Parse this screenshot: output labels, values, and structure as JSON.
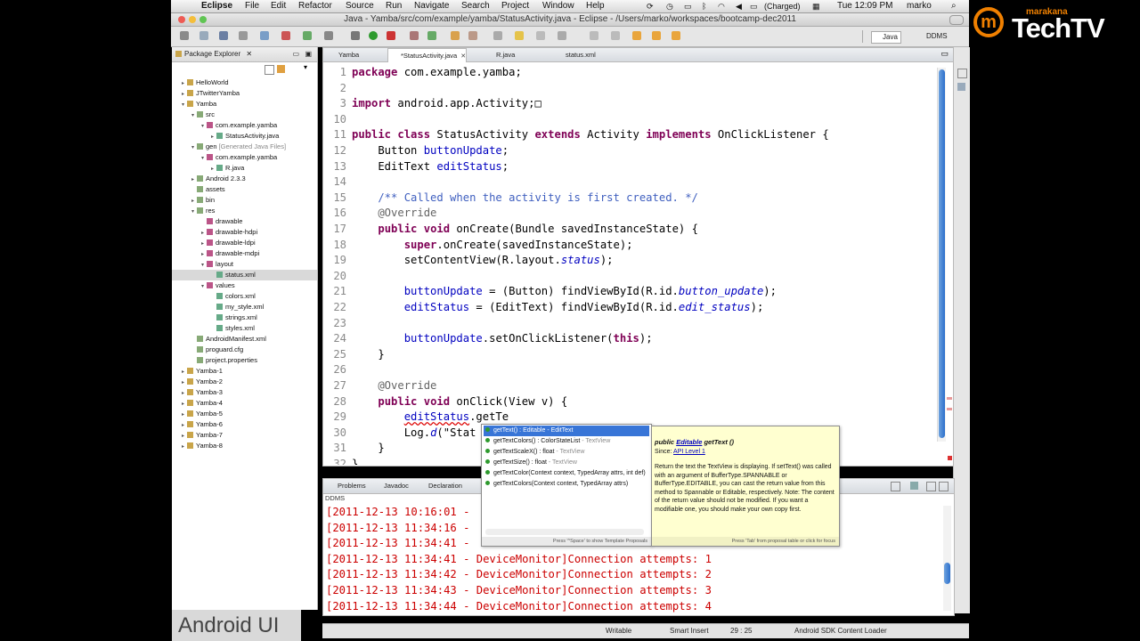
{
  "menubar": {
    "app": "Eclipse",
    "items": [
      "File",
      "Edit",
      "Refactor",
      "Source",
      "Run",
      "Navigate",
      "Search",
      "Project",
      "Window",
      "Help"
    ],
    "battery": "(Charged)",
    "clock": "Tue 12:09 PM",
    "user": "marko"
  },
  "window": {
    "title": "Java - Yamba/src/com/example/yamba/StatusActivity.java - Eclipse - /Users/marko/workspaces/bootcamp-dec2011",
    "perspectives": [
      "Java",
      "DDMS"
    ]
  },
  "package_explorer": {
    "title": "Package Explorer",
    "tree": [
      {
        "label": "HelloWorld",
        "depth": 0,
        "tw": "▸"
      },
      {
        "label": "JTwitterYamba",
        "depth": 0,
        "tw": "▸"
      },
      {
        "label": "Yamba",
        "depth": 0,
        "tw": "▾"
      },
      {
        "label": "src",
        "depth": 1,
        "tw": "▾"
      },
      {
        "label": "com.example.yamba",
        "depth": 2,
        "tw": "▾"
      },
      {
        "label": "StatusActivity.java",
        "depth": 3,
        "tw": "▸"
      },
      {
        "label": "gen",
        "sub": "[Generated Java Files]",
        "depth": 1,
        "tw": "▾"
      },
      {
        "label": "com.example.yamba",
        "depth": 2,
        "tw": "▾"
      },
      {
        "label": "R.java",
        "depth": 3,
        "tw": "▸"
      },
      {
        "label": "Android 2.3.3",
        "depth": 1,
        "tw": "▸"
      },
      {
        "label": "assets",
        "depth": 1,
        "tw": ""
      },
      {
        "label": "bin",
        "depth": 1,
        "tw": "▸"
      },
      {
        "label": "res",
        "depth": 1,
        "tw": "▾"
      },
      {
        "label": "drawable",
        "depth": 2,
        "tw": ""
      },
      {
        "label": "drawable-hdpi",
        "depth": 2,
        "tw": "▸"
      },
      {
        "label": "drawable-ldpi",
        "depth": 2,
        "tw": "▸"
      },
      {
        "label": "drawable-mdpi",
        "depth": 2,
        "tw": "▸"
      },
      {
        "label": "layout",
        "depth": 2,
        "tw": "▾"
      },
      {
        "label": "status.xml",
        "depth": 3,
        "tw": "",
        "selected": true
      },
      {
        "label": "values",
        "depth": 2,
        "tw": "▾"
      },
      {
        "label": "colors.xml",
        "depth": 3,
        "tw": ""
      },
      {
        "label": "my_style.xml",
        "depth": 3,
        "tw": ""
      },
      {
        "label": "strings.xml",
        "depth": 3,
        "tw": ""
      },
      {
        "label": "styles.xml",
        "depth": 3,
        "tw": ""
      },
      {
        "label": "AndroidManifest.xml",
        "depth": 1,
        "tw": ""
      },
      {
        "label": "proguard.cfg",
        "depth": 1,
        "tw": ""
      },
      {
        "label": "project.properties",
        "depth": 1,
        "tw": ""
      },
      {
        "label": "Yamba-1",
        "depth": 0,
        "tw": "▸"
      },
      {
        "label": "Yamba-2",
        "depth": 0,
        "tw": "▸"
      },
      {
        "label": "Yamba-3",
        "depth": 0,
        "tw": "▸"
      },
      {
        "label": "Yamba-4",
        "depth": 0,
        "tw": "▸"
      },
      {
        "label": "Yamba-5",
        "depth": 0,
        "tw": "▸"
      },
      {
        "label": "Yamba-6",
        "depth": 0,
        "tw": "▸"
      },
      {
        "label": "Yamba-7",
        "depth": 0,
        "tw": "▸"
      },
      {
        "label": "Yamba-8",
        "depth": 0,
        "tw": "▸"
      }
    ]
  },
  "editor": {
    "tabs": [
      {
        "label": "Yamba",
        "active": false
      },
      {
        "label": "*StatusActivity.java",
        "active": true
      },
      {
        "label": "R.java",
        "active": false
      },
      {
        "label": "status.xml",
        "active": false
      }
    ],
    "line_numbers": [
      "1",
      "2",
      "3",
      "10",
      "11",
      "12",
      "13",
      "14",
      "15",
      "16",
      "17",
      "18",
      "19",
      "20",
      "21",
      "22",
      "23",
      "24",
      "25",
      "26",
      "27",
      "28",
      "29",
      "30",
      "31",
      "32"
    ],
    "lines": [
      [
        {
          "t": "package",
          "c": "kw"
        },
        {
          "t": " com.example.yamba;"
        }
      ],
      [],
      [
        {
          "t": "import",
          "c": "kw"
        },
        {
          "t": " android.app.Activity;"
        },
        {
          "t": "□"
        }
      ],
      [],
      [
        {
          "t": "public",
          "c": "kw"
        },
        {
          "t": " "
        },
        {
          "t": "class",
          "c": "kw"
        },
        {
          "t": " StatusActivity "
        },
        {
          "t": "extends",
          "c": "kw"
        },
        {
          "t": " Activity "
        },
        {
          "t": "implements",
          "c": "kw"
        },
        {
          "t": " OnClickListener {"
        }
      ],
      [
        {
          "t": "    Button "
        },
        {
          "t": "buttonUpdate",
          "c": "vf"
        },
        {
          "t": ";"
        }
      ],
      [
        {
          "t": "    EditText "
        },
        {
          "t": "editStatus",
          "c": "vf"
        },
        {
          "t": ";"
        }
      ],
      [],
      [
        {
          "t": "    /** Called when the activity is first created. */",
          "c": "cm"
        }
      ],
      [
        {
          "t": "    @Override",
          "c": "an"
        }
      ],
      [
        {
          "t": "    "
        },
        {
          "t": "public",
          "c": "kw"
        },
        {
          "t": " "
        },
        {
          "t": "void",
          "c": "kw"
        },
        {
          "t": " onCreate(Bundle savedInstanceState) {"
        }
      ],
      [
        {
          "t": "        "
        },
        {
          "t": "super",
          "c": "kw"
        },
        {
          "t": ".onCreate(savedInstanceState);"
        }
      ],
      [
        {
          "t": "        setContentView(R.layout."
        },
        {
          "t": "status",
          "c": "it"
        },
        {
          "t": ");"
        }
      ],
      [],
      [
        {
          "t": "        "
        },
        {
          "t": "buttonUpdate",
          "c": "vf"
        },
        {
          "t": " = (Button) findViewById(R.id."
        },
        {
          "t": "button_update",
          "c": "it"
        },
        {
          "t": ");"
        }
      ],
      [
        {
          "t": "        "
        },
        {
          "t": "editStatus",
          "c": "vf"
        },
        {
          "t": " = (EditText) findViewById(R.id."
        },
        {
          "t": "edit_status",
          "c": "it"
        },
        {
          "t": ");"
        }
      ],
      [],
      [
        {
          "t": "        "
        },
        {
          "t": "buttonUpdate",
          "c": "vf"
        },
        {
          "t": ".setOnClickListener("
        },
        {
          "t": "this",
          "c": "kw"
        },
        {
          "t": ");"
        }
      ],
      [
        {
          "t": "    }"
        }
      ],
      [],
      [
        {
          "t": "    @Override",
          "c": "an"
        }
      ],
      [
        {
          "t": "    "
        },
        {
          "t": "public",
          "c": "kw"
        },
        {
          "t": " "
        },
        {
          "t": "void",
          "c": "kw"
        },
        {
          "t": " onClick(View v) {"
        }
      ],
      [
        {
          "t": "        "
        },
        {
          "t": "editStatus",
          "c": "vf err"
        },
        {
          "t": ".getTe"
        }
      ],
      [
        {
          "t": "        Log."
        },
        {
          "t": "d",
          "c": "it"
        },
        {
          "t": "(\"Stat"
        }
      ],
      [
        {
          "t": "    }"
        }
      ],
      [
        {
          "t": "}"
        }
      ]
    ]
  },
  "bottom_panel": {
    "tabs": [
      "Problems",
      "Javadoc",
      "Declaration"
    ],
    "view_label": "DDMS",
    "console": [
      "[2011-12-13 10:16:01 - ",
      "[2011-12-13 11:34:16 - ",
      "[2011-12-13 11:34:41 - ",
      "[2011-12-13 11:34:41 - DeviceMonitor]Connection attempts: 1",
      "[2011-12-13 11:34:42 - DeviceMonitor]Connection attempts: 2",
      "[2011-12-13 11:34:43 - DeviceMonitor]Connection attempts: 3",
      "[2011-12-13 11:34:44 - DeviceMonitor]Connection attempts: 4"
    ]
  },
  "content_assist": {
    "proposals": [
      {
        "name": "getText() : Editable",
        "cls": " - EditText",
        "selected": true
      },
      {
        "name": "getTextColors() : ColorStateList",
        "cls": " - TextView"
      },
      {
        "name": "getTextScaleX() : float",
        "cls": " - TextView"
      },
      {
        "name": "getTextSize() : float",
        "cls": " - TextView"
      },
      {
        "name": "getTextColor(Context context, TypedArray attrs, int def)",
        "cls": ""
      },
      {
        "name": "getTextColors(Context context, TypedArray attrs)",
        "cls": ""
      }
    ],
    "footer": "Press '^Space' to show Template Proposals"
  },
  "doc_popup": {
    "sig_prefix": "public",
    "sig_type": "Editable",
    "sig_method": "getText ()",
    "since_label": "Since:",
    "since_link": "API Level 1",
    "body": "Return the text the TextView is displaying. If setText() was called with an argument of BufferType.SPANNABLE or BufferType.EDITABLE, you can cast the return value from this method to Spannable or Editable, respectively. Note: The content of the return value should not be modified. If you want a modifiable one, you should make your own copy first.",
    "footer": "Press 'Tab' from proposal table or click for focus"
  },
  "statusbar": {
    "writable": "Writable",
    "insert_mode": "Smart Insert",
    "position": "29 : 25",
    "task": "Android SDK Content Loader"
  },
  "watermark": "Android UI",
  "logo": {
    "small": "marakana",
    "big": "TechTV",
    "letter": "m"
  },
  "colors": {
    "accent": "#f08000",
    "keyword": "#7f0055",
    "comment": "#3f5fbf",
    "field": "#0000c0",
    "console": "#cc0000",
    "selection": "#3875d7"
  }
}
